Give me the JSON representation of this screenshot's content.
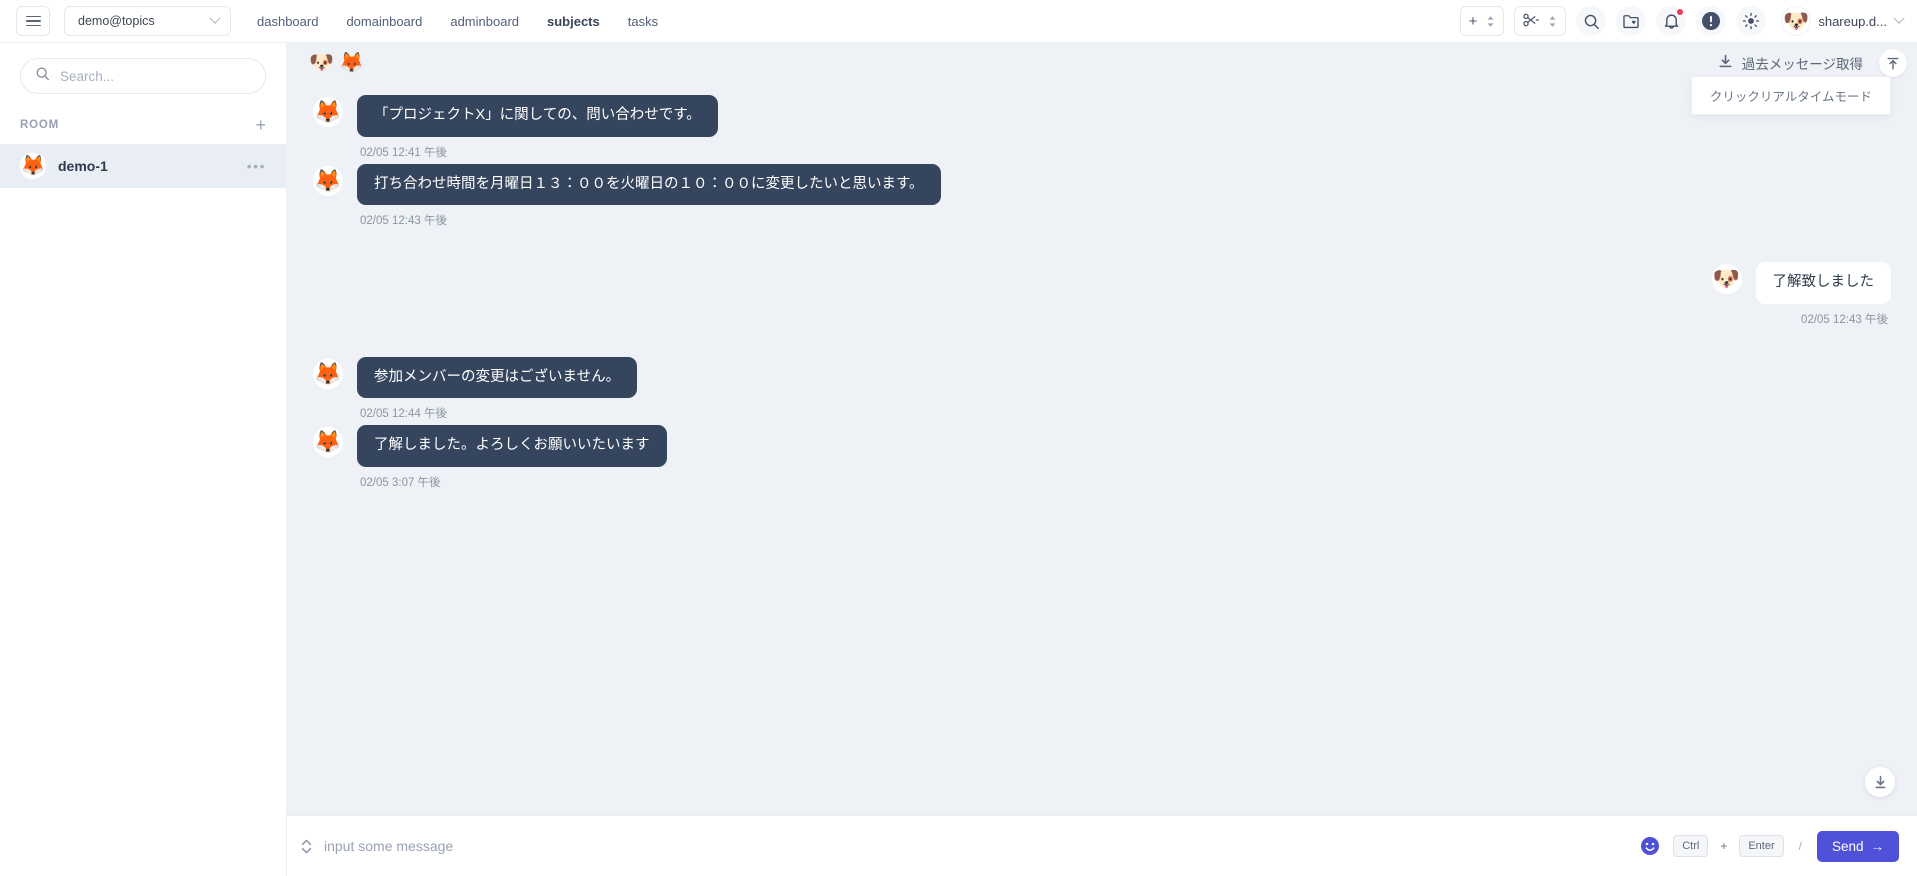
{
  "topbar": {
    "menu_icon": "hamburger-icon",
    "workspace": {
      "value": "demo@topics",
      "chevron": "chevron-down-icon"
    },
    "nav": [
      {
        "label": "dashboard",
        "strong": false
      },
      {
        "label": "domainboard",
        "strong": false
      },
      {
        "label": "adminboard",
        "strong": false
      },
      {
        "label": "subjects",
        "strong": true
      },
      {
        "label": "tasks",
        "strong": false
      }
    ],
    "steppers": [
      {
        "name": "add-stepper",
        "glyph": "+"
      },
      {
        "name": "cut-stepper",
        "glyph": "✂"
      }
    ],
    "icons": [
      {
        "name": "search-icon"
      },
      {
        "name": "folder-favorite-icon"
      },
      {
        "name": "notifications-bell-icon",
        "badge": true
      },
      {
        "name": "alert-info-icon"
      },
      {
        "name": "brightness-icon"
      }
    ],
    "profile": {
      "name": "shareup.d...",
      "avatar": "🐶",
      "chevron": "chevron-down-icon"
    }
  },
  "sidebar": {
    "search": {
      "placeholder": "Search...",
      "value": "",
      "icon": "search-icon"
    },
    "room_section": {
      "label": "ROOM",
      "add_label": "+"
    },
    "rooms": [
      {
        "name": "demo-1",
        "avatar": "🦊",
        "active": true,
        "more": "•••"
      }
    ]
  },
  "chat": {
    "members": [
      "🐶",
      "🦊"
    ],
    "fetch_past_label": "過去メッセージ取得",
    "fetch_past_icon": "download-icon",
    "pin_icon": "pin-top-icon",
    "tooltip": "クリックリアルタイムモード",
    "scroll_down_icon": "scroll-to-bottom-icon",
    "messages": [
      {
        "id": "m1",
        "direction": "in",
        "avatar": "🦊",
        "text": "「プロジェクトX」に関しての、問い合わせです。",
        "time": "02/05 12:41 午後"
      },
      {
        "id": "m2",
        "direction": "in",
        "avatar": "🦊",
        "text": "打ち合わせ時間を月曜日１３：００を火曜日の１０：００に変更したいと思います。",
        "time": "02/05 12:43 午後"
      },
      {
        "id": "m3",
        "direction": "out",
        "avatar": "🐶",
        "text": "了解致しました",
        "time": "02/05 12:43 午後"
      },
      {
        "id": "m4",
        "direction": "in",
        "avatar": "🦊",
        "text": "参加メンバーの変更はございません。",
        "time": "02/05 12:44 午後"
      },
      {
        "id": "m5",
        "direction": "in",
        "avatar": "🦊",
        "text": "了解しました。よろしくお願いいたいます",
        "time": "02/05 3:07 午後"
      }
    ]
  },
  "composer": {
    "expand_icon": "expand-collapse-icon",
    "placeholder": "input some message",
    "value": "",
    "emoji_icon": "emoji-smiley-icon",
    "shortcut": {
      "key1": "Ctrl",
      "plus": "+",
      "key2": "Enter",
      "separator": "/"
    },
    "send_label": "Send",
    "send_arrow": "→"
  },
  "colors": {
    "accent": "#4f51d8",
    "bubble_in": "#35455e",
    "bubble_out": "#ffffff",
    "chat_bg": "#eef1f6",
    "badge": "#f2385a",
    "sidebar_active": "#e9edf4"
  }
}
